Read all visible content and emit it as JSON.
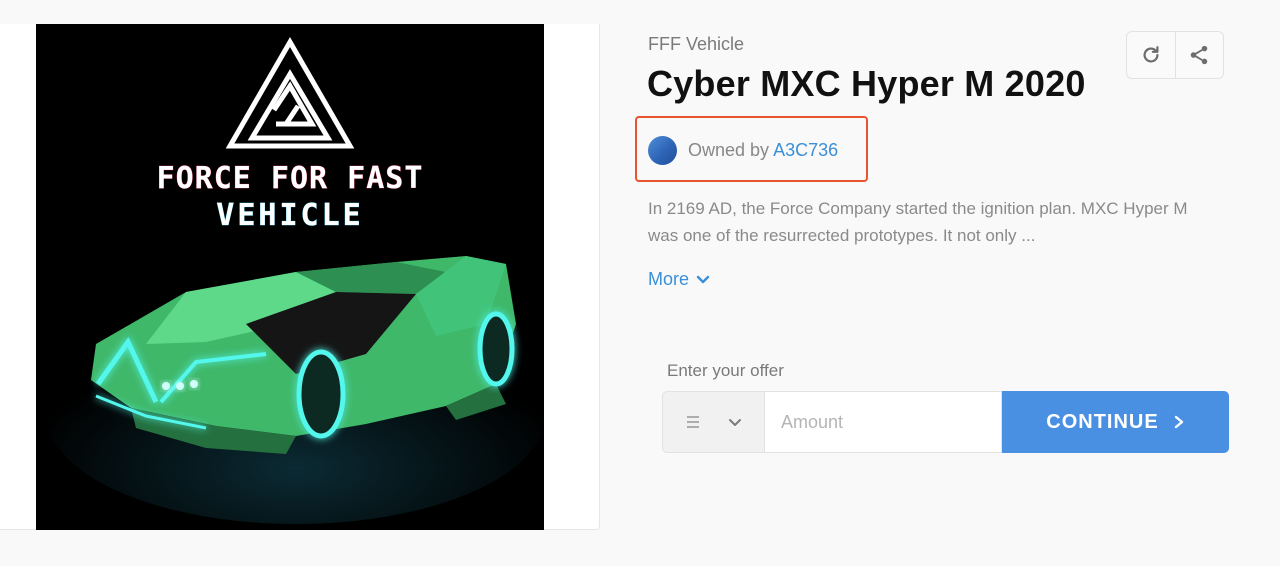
{
  "artwork": {
    "logo_line1": "FORCE FOR FAST",
    "logo_line2": "VEHICLE",
    "glow_color": "#52f7ec",
    "body_color": "#4ed37a"
  },
  "item": {
    "collection": "FFF Vehicle",
    "title": "Cyber MXC Hyper M 2020",
    "owner_prefix": "Owned by",
    "owner_name": "A3C736",
    "description_line1": "In 2169 AD, the Force Company started the ignition plan. MXC Hyper M",
    "description_line2": "was one of the resurrected prototypes. It not only ...",
    "more_label": "More"
  },
  "actions": {
    "refresh_icon": "refresh-icon",
    "share_icon": "share-icon"
  },
  "offer": {
    "label": "Enter your offer",
    "currency_icon": "ethereum-icon",
    "amount_placeholder": "Amount",
    "continue_label": "CONTINUE"
  },
  "colors": {
    "accent": "#4a90e2",
    "link": "#3b8fd8",
    "highlight_border": "#e8542e"
  }
}
